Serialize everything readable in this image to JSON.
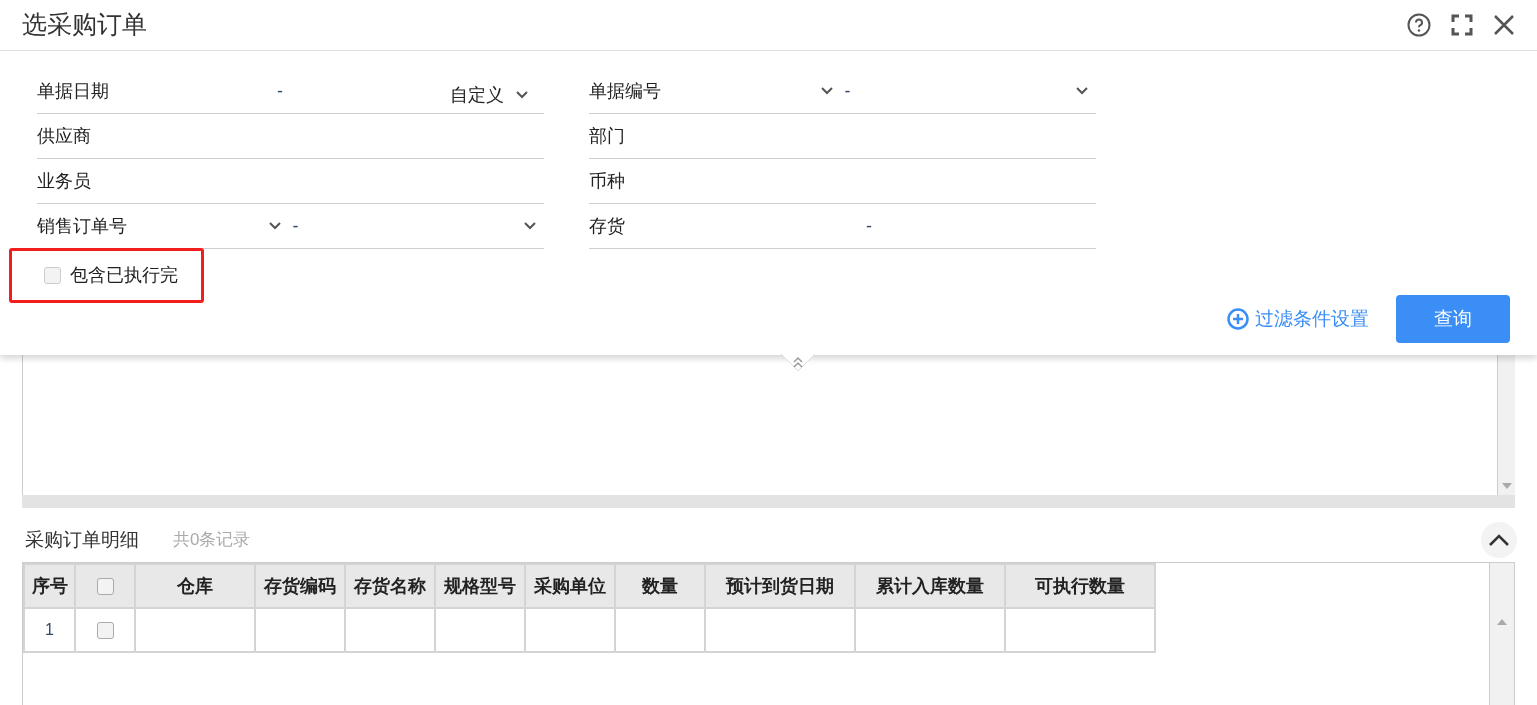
{
  "window": {
    "title": "选采购订单"
  },
  "filters": {
    "left": [
      {
        "kind": "date-range",
        "label": "单据日期",
        "separator": "-",
        "value": "自定义"
      },
      {
        "kind": "plain",
        "label": "供应商"
      },
      {
        "kind": "plain",
        "label": "业务员"
      },
      {
        "kind": "select-range",
        "label": "销售订单号",
        "separator": "-"
      }
    ],
    "right": [
      {
        "kind": "select-range",
        "label": "单据编号",
        "separator": "-"
      },
      {
        "kind": "plain",
        "label": "部门"
      },
      {
        "kind": "plain",
        "label": "币种"
      },
      {
        "kind": "range",
        "label": "存货",
        "separator": "-"
      }
    ]
  },
  "include_completed": {
    "label": "包含已执行完",
    "checked": false,
    "highlighted": true
  },
  "filter_settings_link": "过滤条件设置",
  "query_button": "查询",
  "details": {
    "title": "采购订单明细",
    "count": "共0条记录",
    "columns": [
      "序号",
      "",
      "仓库",
      "存货编码",
      "存货名称",
      "规格型号",
      "采购单位",
      "数量",
      "预计到货日期",
      "累计入库数量",
      "可执行数量"
    ],
    "all_checked": false,
    "rows": [
      {
        "index": "1",
        "checked": false
      }
    ]
  }
}
